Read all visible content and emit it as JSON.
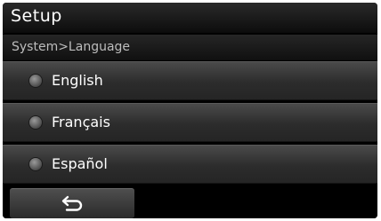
{
  "header": {
    "title": "Setup"
  },
  "breadcrumb": {
    "text": "System>Language"
  },
  "languages": [
    {
      "label": "English",
      "selected": false
    },
    {
      "label": "Français",
      "selected": false
    },
    {
      "label": "Español",
      "selected": false
    }
  ],
  "footer": {
    "back_icon": "back-arrow-icon"
  }
}
